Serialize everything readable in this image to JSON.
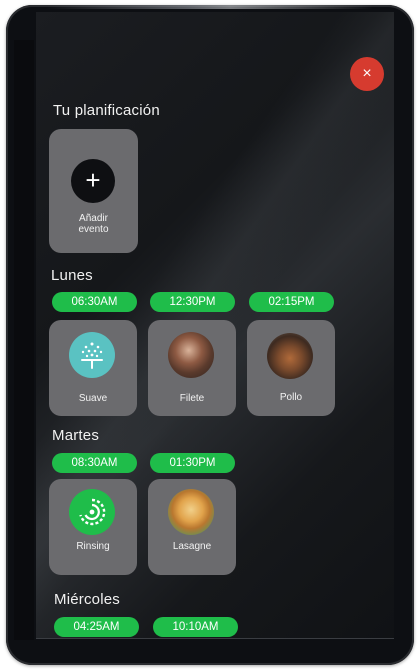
{
  "header": {
    "title": "Tu planificación",
    "close_symbol": "×"
  },
  "add_event": {
    "symbol": "+",
    "label": "Añadir\nevento"
  },
  "days": [
    {
      "name": "Lunes",
      "times": [
        "06:30AM",
        "12:30PM",
        "02:15PM"
      ],
      "items": [
        {
          "label": "Suave",
          "icon": "steam-icon"
        },
        {
          "label": "Filete",
          "icon": "steak-photo"
        },
        {
          "label": "Pollo",
          "icon": "chicken-photo"
        }
      ]
    },
    {
      "name": "Martes",
      "times": [
        "08:30AM",
        "01:30PM"
      ],
      "items": [
        {
          "label": "Rinsing",
          "icon": "rinse-icon"
        },
        {
          "label": "Lasagne",
          "icon": "lasagne-photo"
        }
      ]
    },
    {
      "name": "Miércoles",
      "times": [
        "04:25AM",
        "10:10AM"
      ]
    }
  ],
  "colors": {
    "accent_green": "#1fbd4a",
    "close_red": "#d63b2f",
    "card_gray": "#6b6b6e",
    "steam_teal": "#5ac2c2"
  }
}
